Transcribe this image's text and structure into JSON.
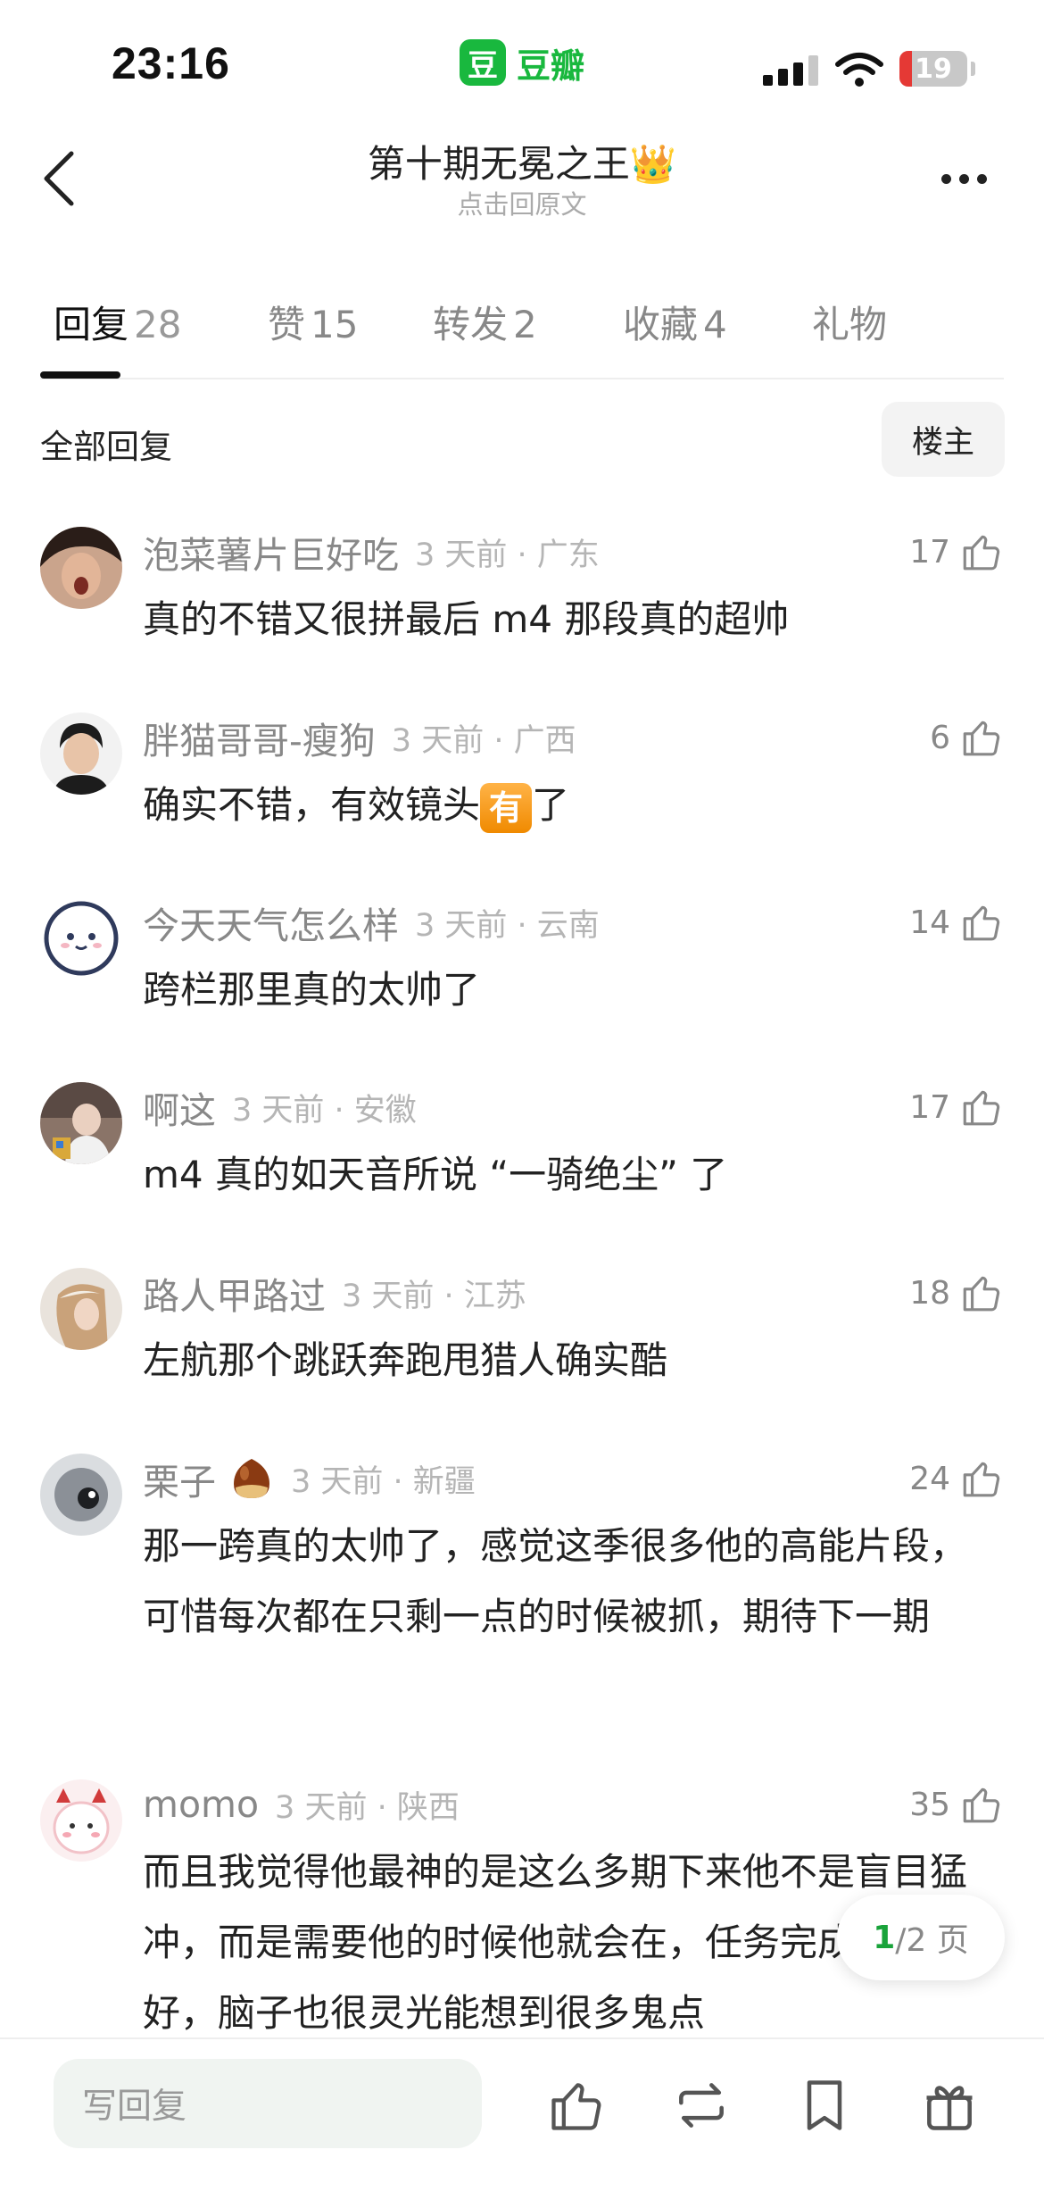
{
  "status_bar": {
    "time": "23:16",
    "app_logo": "豆",
    "app_name": "豆瓣",
    "battery": "19",
    "battery_level": 0.19,
    "battery_color": "#e53935"
  },
  "nav": {
    "title": "第十期无冕之王👑",
    "subtitle": "点击回原文",
    "back_icon": "chevron-left-icon",
    "more_icon": "ellipsis-icon"
  },
  "tabs": [
    {
      "label": "回复",
      "count": "28",
      "active": true
    },
    {
      "label": "赞",
      "count": "15",
      "active": false
    },
    {
      "label": "转发",
      "count": "2",
      "active": false
    },
    {
      "label": "收藏",
      "count": "4",
      "active": false
    },
    {
      "label": "礼物",
      "count": "",
      "active": false
    }
  ],
  "section": {
    "title": "全部回复",
    "op_button": "楼主"
  },
  "comments": [
    {
      "user": "泡菜薯片巨好吃",
      "meta": "3 天前 · 广东",
      "likes": "17",
      "text": "真的不错又很拼最后 m4 那段真的超帅"
    },
    {
      "user": "胖猫哥哥-瘦狗",
      "meta": "3 天前 · 广西",
      "likes": "6",
      "text_before": "确实不错，有效镜头",
      "emoji": "有",
      "text_after": "了"
    },
    {
      "user": "今天天气怎么样",
      "meta": "3 天前 · 云南",
      "likes": "14",
      "text": "跨栏那里真的太帅了"
    },
    {
      "user": "啊这",
      "meta": "3 天前 · 安徽",
      "likes": "17",
      "text": "m4 真的如天音所说 “一骑绝尘” 了"
    },
    {
      "user": "路人甲路过",
      "meta": "3 天前 · 江苏",
      "likes": "18",
      "text": "左航那个跳跃奔跑甩猎人确实酷"
    },
    {
      "user": "栗子",
      "meta": "3 天前 · 新疆",
      "likes": "24",
      "text": "那一跨真的太帅了，感觉这季很多他的高能片段，可惜每次都在只剩一点的时候被抓，期待下一期"
    },
    {
      "user": "momo",
      "meta": "3 天前 · 陕西",
      "likes": "35",
      "text": "而且我觉得他最神的是这么多期下来他不是盲目猛冲，而是需要他的时候他就会在，任务完成的非常好，脑子也很灵光能想到很多鬼点"
    }
  ],
  "pagination": {
    "current": "1",
    "total": "/2 页"
  },
  "bottom_bar": {
    "reply_placeholder": "写回复",
    "icons": [
      "thumbs-up-icon",
      "repost-icon",
      "bookmark-icon",
      "gift-icon"
    ]
  },
  "colors": {
    "brand_green": "#19b83e",
    "muted_text": "#888888"
  }
}
